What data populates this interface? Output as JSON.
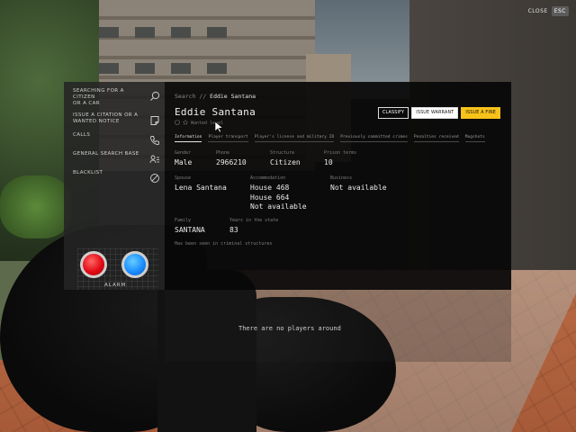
{
  "close": {
    "label": "CLOSE",
    "key": "ESC"
  },
  "sidebar": {
    "items": [
      {
        "label_line1": "SEARCHING FOR A",
        "label_line2": "CITIZEN",
        "label_line3": "OR A CAR",
        "icon": "search-icon"
      },
      {
        "label_line1": "ISSUE A CITATION OR A",
        "label_line2": "WANTED NOTICE",
        "icon": "note-icon"
      },
      {
        "label_line1": "CALLS",
        "icon": "phone-icon"
      },
      {
        "label_line1": "GENERAL SEARCH BASE",
        "icon": "users-list-icon"
      },
      {
        "label_line1": "BLACKLIST",
        "icon": "block-icon"
      }
    ],
    "alarm_label": "ALARM"
  },
  "breadcrumb": {
    "root": "Search",
    "sep": "//",
    "current": "Eddie Santana"
  },
  "person": {
    "name": "Eddie Santana",
    "status_text": "Wanted level"
  },
  "actions": {
    "classify": "CLASSIFY",
    "warrant": "ISSUE WARRANT",
    "fine": "ISSUE A FINE"
  },
  "tabs": [
    {
      "label": "Information"
    },
    {
      "label": "Player transport"
    },
    {
      "label": "Player's license and military ID"
    },
    {
      "label": "Previously committed crimes"
    },
    {
      "label": "Penalties received"
    },
    {
      "label": "Mugshots"
    }
  ],
  "info": {
    "gender": {
      "key": "Gender",
      "value": "Male"
    },
    "phone": {
      "key": "Phone",
      "value": "2966210"
    },
    "structure": {
      "key": "Structure",
      "value": "Citizen"
    },
    "prison": {
      "key": "Prison terms",
      "value": "10"
    },
    "spouse": {
      "key": "Spouse",
      "value": "Lena Santana"
    },
    "accommodation": {
      "key": "Accommodation",
      "values": [
        "House 468",
        "House 664",
        "Not available"
      ]
    },
    "business": {
      "key": "Business",
      "value": "Not available"
    },
    "family": {
      "key": "Family",
      "value": "SANTANA"
    },
    "years": {
      "key": "Years in the state",
      "value": "83"
    },
    "note": "Has been seen in criminal structures"
  },
  "messages": {
    "empty": "There are no players around"
  },
  "colors": {
    "accent_yellow": "#f7c21a",
    "alarm_red": "#e20a14",
    "alarm_blue": "#1c8fff"
  }
}
